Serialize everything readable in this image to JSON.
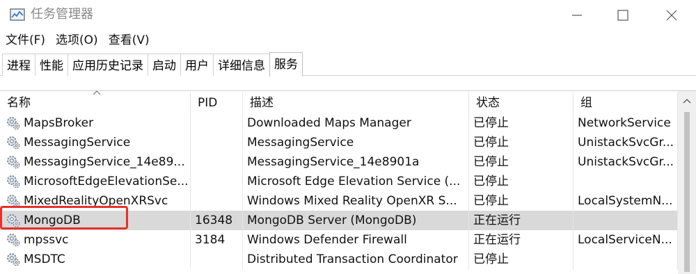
{
  "window": {
    "title": "任务管理器",
    "icons": {
      "app": "task-manager-icon",
      "minimize": "minimize-icon",
      "maximize": "maximize-icon",
      "close": "close-icon"
    }
  },
  "menu": [
    {
      "label": "文件(F)"
    },
    {
      "label": "选项(O)"
    },
    {
      "label": "查看(V)"
    }
  ],
  "tabs": [
    {
      "label": "进程"
    },
    {
      "label": "性能"
    },
    {
      "label": "应用历史记录"
    },
    {
      "label": "启动"
    },
    {
      "label": "用户"
    },
    {
      "label": "详细信息"
    },
    {
      "label": "服务",
      "active": true
    }
  ],
  "columns": {
    "name": "名称",
    "pid": "PID",
    "desc": "描述",
    "status": "状态",
    "group": "组"
  },
  "rows": [
    {
      "name": "MapsBroker",
      "pid": "",
      "desc": "Downloaded Maps Manager",
      "status": "已停止",
      "group": "NetworkService"
    },
    {
      "name": "MessagingService",
      "pid": "",
      "desc": "MessagingService",
      "status": "已停止",
      "group": "UnistackSvcGr..."
    },
    {
      "name": "MessagingService_14e89...",
      "pid": "",
      "desc": "MessagingService_14e8901a",
      "status": "已停止",
      "group": "UnistackSvcGr..."
    },
    {
      "name": "MicrosoftEdgeElevationSe...",
      "pid": "",
      "desc": "Microsoft Edge Elevation Service (...",
      "status": "已停止",
      "group": ""
    },
    {
      "name": "MixedRealityOpenXRSvc",
      "pid": "",
      "desc": "Windows Mixed Reality OpenXR S...",
      "status": "已停止",
      "group": "LocalSystemN..."
    },
    {
      "name": "MongoDB",
      "pid": "16348",
      "desc": "MongoDB Server (MongoDB)",
      "status": "正在运行",
      "group": "",
      "selected": true
    },
    {
      "name": "mpssvc",
      "pid": "3184",
      "desc": "Windows Defender Firewall",
      "status": "正在运行",
      "group": "LocalServiceN..."
    },
    {
      "name": "MSDTC",
      "pid": "",
      "desc": "Distributed Transaction Coordinator",
      "status": "已停止",
      "group": ""
    }
  ],
  "colors": {
    "selected_row": "#d9d9d9",
    "highlight_box": "#e8302b"
  }
}
